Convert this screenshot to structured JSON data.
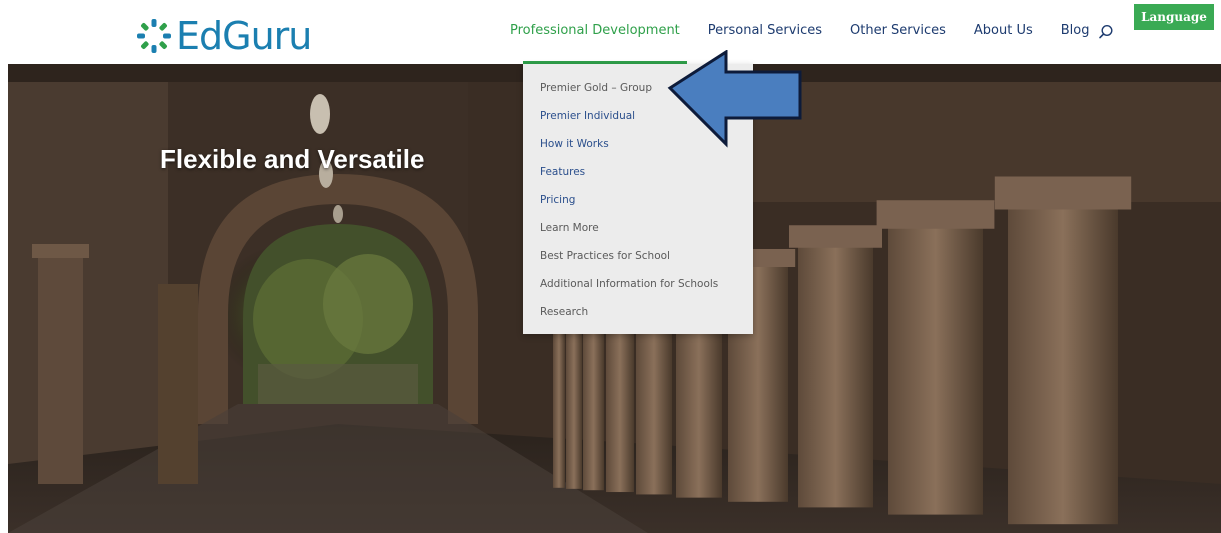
{
  "logo": {
    "text": "EdGuru",
    "colors": {
      "primary": "#1b7fb0",
      "accent": "#2fa04a"
    }
  },
  "nav": {
    "items": [
      {
        "label": "Professional Development",
        "active": true
      },
      {
        "label": "Personal Services",
        "active": false
      },
      {
        "label": "Other Services",
        "active": false
      },
      {
        "label": "About Us",
        "active": false
      },
      {
        "label": "Blog",
        "active": false
      }
    ],
    "search_icon": "search-icon",
    "language_label": "Language",
    "colors": {
      "text": "#1d3b6f",
      "active": "#2fa04a",
      "language_bg": "#3aaa54"
    }
  },
  "hero": {
    "title": "Flexible and Versatile"
  },
  "dropdown": {
    "items": [
      {
        "label": "Premier Gold – Group",
        "style": "muted"
      },
      {
        "label": "Premier Individual",
        "style": "link"
      },
      {
        "label": "How it Works",
        "style": "link"
      },
      {
        "label": "Features",
        "style": "link"
      },
      {
        "label": "Pricing",
        "style": "link"
      },
      {
        "label": "Learn More",
        "style": "muted"
      },
      {
        "label": "Best Practices for School",
        "style": "muted"
      },
      {
        "label": "Additional Information for Schools",
        "style": "muted"
      },
      {
        "label": "Research",
        "style": "muted"
      }
    ]
  },
  "annotation": {
    "arrow_icon": "left-arrow-icon",
    "fill": "#4a7ebf",
    "stroke": "#0d1b3a"
  }
}
